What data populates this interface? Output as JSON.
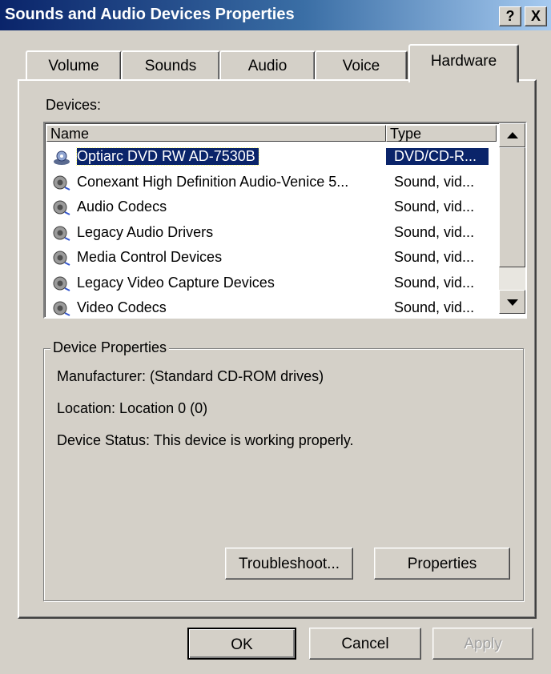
{
  "window": {
    "title": "Sounds and Audio Devices Properties",
    "help_label": "?",
    "close_label": "X"
  },
  "tabs": [
    {
      "label": "Volume"
    },
    {
      "label": "Sounds"
    },
    {
      "label": "Audio"
    },
    {
      "label": "Voice"
    },
    {
      "label": "Hardware",
      "active": true
    }
  ],
  "devices": {
    "label": "Devices:",
    "columns": {
      "name": "Name",
      "type": "Type"
    },
    "rows": [
      {
        "name": "Optiarc DVD RW AD-7530B",
        "type": "DVD/CD-R...",
        "icon": "dvd-drive-icon",
        "selected": true
      },
      {
        "name": "Conexant High Definition Audio-Venice 5...",
        "type": "Sound, vid...",
        "icon": "speaker-icon"
      },
      {
        "name": "Audio Codecs",
        "type": "Sound, vid...",
        "icon": "speaker-icon"
      },
      {
        "name": "Legacy Audio Drivers",
        "type": "Sound, vid...",
        "icon": "speaker-icon"
      },
      {
        "name": "Media Control Devices",
        "type": "Sound, vid...",
        "icon": "speaker-icon"
      },
      {
        "name": "Legacy Video Capture Devices",
        "type": "Sound, vid...",
        "icon": "speaker-icon"
      },
      {
        "name": "Video Codecs",
        "type": "Sound, vid...",
        "icon": "speaker-icon"
      }
    ]
  },
  "device_properties": {
    "title": "Device Properties",
    "manufacturer": "Manufacturer: (Standard CD-ROM drives)",
    "location": "Location: Location 0 (0)",
    "status": "Device Status: This device is working properly.",
    "troubleshoot_label": "Troubleshoot...",
    "properties_label": "Properties"
  },
  "footer": {
    "ok_label": "OK",
    "cancel_label": "Cancel",
    "apply_label": "Apply"
  },
  "colors": {
    "titlebar_start": "#0a246a",
    "titlebar_end": "#a6caf0",
    "selection": "#0a246a",
    "face": "#d4d0c8"
  }
}
